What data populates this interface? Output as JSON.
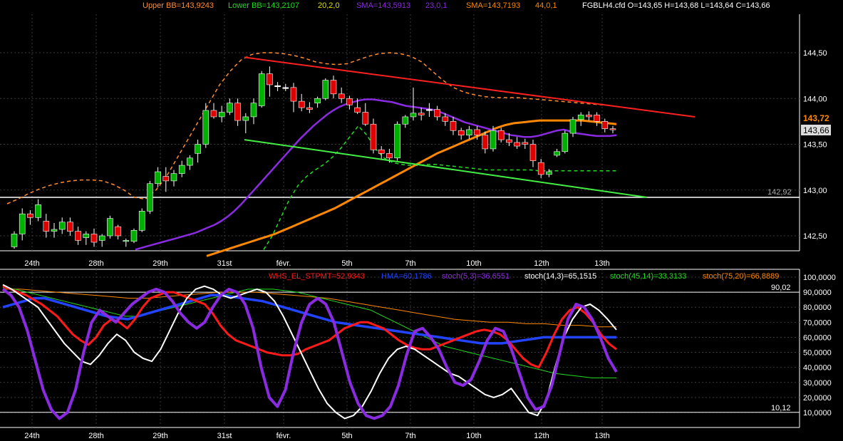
{
  "colors": {
    "background": "#000000",
    "grid": "#3a3a3a",
    "up_candle": "#00b000",
    "down_candle": "#e00000",
    "doji_candle": "#ffffff",
    "bb": "#ff8c33",
    "bb_lower": "#22dd22",
    "sma23": "#8a2be2",
    "sma44": "#ff8800",
    "trend_upper": "#ff2020",
    "trend_lower": "#44ee44",
    "whs": "#ff1a1a",
    "hma": "#2244ff",
    "stoch5": "#8a2be2",
    "stoch14": "#ffffff",
    "stoch45": "#22dd22",
    "stoch75": "#ff8800"
  },
  "header": {
    "upper_bb": "Upper BB=143,9243",
    "lower_bb": "Lower BB=143,2107",
    "bb_params": "20,2,0",
    "sma1": "SMA=143,5913",
    "sma1_params": "23,0,1",
    "sma2": "SMA=143,7193",
    "sma2_params": "44,0,1",
    "ohlc": "FGBLH4.cfd O=143,65 H=143,68 L=143,64 C=143,66"
  },
  "price_badges": {
    "sma": "143,72",
    "last": "143,66",
    "support": "142,92"
  },
  "osc_header": {
    "whs": "WHS_EL_STPMT=52,9343",
    "hma": "HMA=60,1786",
    "stoch5": "stoch(5,3)=36,6551",
    "stoch14": "stoch(14,3)=65,1515",
    "stoch45": "stoch(45,14)=33,3133",
    "stoch75": "stoch(75,20)=66,8889"
  },
  "osc_badges": {
    "upper": "90,02",
    "lower": "10,12"
  },
  "x_labels": [
    "24th",
    "28th",
    "29th",
    "31st",
    "févr.",
    "5th",
    "7th",
    "10th",
    "12th",
    "13th"
  ],
  "chart_data": [
    {
      "type": "candlestick",
      "instrument": "FGBLH4.cfd",
      "ylim": [
        142.35,
        144.62
      ],
      "y_ticks": [
        "142,50",
        "143,00",
        "143,50",
        "144,00",
        "144,50"
      ],
      "horizontal_line": 142.92,
      "candles": [
        [
          142.38,
          142.55,
          142.36,
          142.52
        ],
        [
          142.52,
          142.8,
          142.45,
          142.74
        ],
        [
          142.74,
          142.78,
          142.62,
          142.7
        ],
        [
          142.7,
          142.9,
          142.66,
          142.84
        ],
        [
          142.66,
          142.74,
          142.48,
          142.55
        ],
        [
          142.55,
          142.64,
          142.48,
          142.57
        ],
        [
          142.57,
          142.7,
          142.52,
          142.65
        ],
        [
          142.65,
          142.7,
          142.5,
          142.55
        ],
        [
          142.55,
          142.6,
          142.4,
          142.45
        ],
        [
          142.48,
          142.55,
          142.4,
          142.52
        ],
        [
          142.52,
          142.58,
          142.38,
          142.43
        ],
        [
          142.45,
          142.52,
          142.38,
          142.5
        ],
        [
          142.5,
          142.72,
          142.47,
          142.69
        ],
        [
          142.6,
          142.62,
          142.46,
          142.5
        ],
        [
          142.44,
          142.47,
          142.38,
          142.45
        ],
        [
          142.44,
          142.58,
          142.42,
          142.56
        ],
        [
          142.56,
          142.8,
          142.54,
          142.77
        ],
        [
          142.77,
          143.1,
          142.74,
          143.07
        ],
        [
          143.07,
          143.25,
          143.03,
          143.2
        ],
        [
          143.15,
          143.25,
          142.98,
          143.1
        ],
        [
          143.1,
          143.22,
          143.04,
          143.18
        ],
        [
          143.18,
          143.32,
          143.14,
          143.27
        ],
        [
          143.27,
          143.38,
          143.22,
          143.35
        ],
        [
          143.4,
          143.55,
          143.3,
          143.5
        ],
        [
          143.5,
          143.95,
          143.46,
          143.87
        ],
        [
          143.87,
          143.95,
          143.78,
          143.8
        ],
        [
          143.8,
          143.92,
          143.74,
          143.85
        ],
        [
          143.85,
          144.0,
          143.82,
          143.95
        ],
        [
          143.95,
          144.0,
          143.7,
          143.76
        ],
        [
          143.76,
          143.84,
          143.62,
          143.8
        ],
        [
          143.8,
          144.0,
          143.72,
          143.95
        ],
        [
          143.92,
          144.3,
          143.9,
          144.27
        ],
        [
          144.27,
          144.35,
          144.02,
          144.15
        ],
        [
          144.14,
          144.18,
          144.08,
          144.14
        ],
        [
          144.12,
          144.16,
          144.08,
          144.12
        ],
        [
          144.12,
          144.17,
          143.85,
          143.97
        ],
        [
          143.97,
          144.05,
          143.86,
          143.9
        ],
        [
          143.9,
          143.96,
          143.84,
          143.88
        ],
        [
          143.95,
          144.02,
          143.9,
          144.0
        ],
        [
          144.0,
          144.22,
          143.98,
          144.2
        ],
        [
          144.2,
          144.25,
          144.0,
          144.05
        ],
        [
          144.05,
          144.12,
          143.95,
          144.0
        ],
        [
          144.0,
          144.03,
          143.88,
          143.93
        ],
        [
          143.9,
          144.0,
          143.83,
          143.85
        ],
        [
          143.85,
          143.95,
          143.7,
          143.72
        ],
        [
          143.72,
          143.78,
          143.4,
          143.44
        ],
        [
          143.44,
          143.48,
          143.33,
          143.4
        ],
        [
          143.4,
          143.45,
          143.3,
          143.35
        ],
        [
          143.35,
          143.75,
          143.32,
          143.72
        ],
        [
          143.72,
          143.82,
          143.68,
          143.8
        ],
        [
          143.8,
          144.12,
          143.76,
          143.84
        ],
        [
          143.84,
          143.9,
          143.76,
          143.82
        ],
        [
          143.88,
          143.95,
          143.8,
          143.88
        ],
        [
          143.88,
          143.92,
          143.76,
          143.8
        ],
        [
          143.8,
          143.84,
          143.7,
          143.75
        ],
        [
          143.75,
          143.8,
          143.6,
          143.65
        ],
        [
          143.65,
          143.68,
          143.55,
          143.6
        ],
        [
          143.6,
          143.7,
          143.56,
          143.66
        ],
        [
          143.66,
          143.7,
          143.55,
          143.6
        ],
        [
          143.6,
          143.64,
          143.4,
          143.45
        ],
        [
          143.45,
          143.7,
          143.42,
          143.65
        ],
        [
          143.65,
          143.68,
          143.52,
          143.55
        ],
        [
          143.55,
          143.62,
          143.48,
          143.52
        ],
        [
          143.52,
          143.58,
          143.45,
          143.48
        ],
        [
          143.52,
          143.56,
          143.45,
          143.5
        ],
        [
          143.5,
          143.55,
          143.25,
          143.32
        ],
        [
          143.3,
          143.34,
          143.13,
          143.17
        ],
        [
          143.17,
          143.23,
          143.14,
          143.2
        ],
        [
          143.38,
          143.45,
          143.36,
          143.42
        ],
        [
          143.42,
          143.65,
          143.4,
          143.62
        ],
        [
          143.62,
          143.8,
          143.58,
          143.77
        ],
        [
          143.77,
          143.85,
          143.7,
          143.82
        ],
        [
          143.82,
          143.86,
          143.76,
          143.8
        ],
        [
          143.82,
          143.85,
          143.7,
          143.75
        ],
        [
          143.75,
          143.78,
          143.63,
          143.67
        ],
        [
          143.67,
          143.7,
          143.62,
          143.66
        ]
      ],
      "sma23": [
        142.35,
        142.37,
        142.39,
        142.41,
        142.43,
        142.45,
        142.47,
        142.49,
        142.51,
        142.53,
        142.56,
        142.59,
        142.62,
        142.66,
        142.71,
        142.77,
        142.84,
        142.92,
        143.0,
        143.08,
        143.16,
        143.24,
        143.32,
        143.4,
        143.48,
        143.56,
        143.63,
        143.7,
        143.76,
        143.82,
        143.87,
        143.91,
        143.94,
        143.96,
        143.98,
        143.99,
        143.99,
        143.98,
        143.97,
        143.96,
        143.94,
        143.92,
        143.91,
        143.9,
        143.89,
        143.88,
        143.86,
        143.83,
        143.8,
        143.77,
        143.74,
        143.72,
        143.7,
        143.68,
        143.66,
        143.64,
        143.62,
        143.6,
        143.59,
        143.58,
        143.58,
        143.59,
        143.61,
        143.63,
        143.65,
        143.66,
        143.64,
        143.62,
        143.61,
        143.6,
        143.59,
        143.59,
        143.59,
        143.6
      ],
      "sma44": [
        142.28,
        142.31,
        142.34,
        142.37,
        142.4,
        142.43,
        142.46,
        142.49,
        142.52,
        142.56,
        142.6,
        142.64,
        142.68,
        142.72,
        142.76,
        142.8,
        142.85,
        142.9,
        142.95,
        143.0,
        143.05,
        143.1,
        143.15,
        143.2,
        143.25,
        143.3,
        143.35,
        143.4,
        143.44,
        143.48,
        143.52,
        143.56,
        143.6,
        143.64,
        143.68,
        143.71,
        143.73,
        143.74,
        143.75,
        143.76,
        143.76,
        143.76,
        143.76,
        143.76,
        143.76,
        143.75,
        143.74,
        143.73,
        143.72
      ],
      "bb_upper": [
        142.85,
        142.9,
        142.96,
        143.01,
        143.05,
        143.08,
        143.1,
        143.11,
        143.11,
        143.1,
        143.06,
        143.0,
        142.92,
        142.9,
        143.0,
        143.15,
        143.35,
        143.55,
        143.75,
        143.95,
        144.15,
        144.3,
        144.42,
        144.48,
        144.5,
        144.5,
        144.49,
        144.47,
        144.44,
        144.4,
        144.38,
        144.37,
        144.38,
        144.42,
        144.46,
        144.49,
        144.5,
        144.49,
        144.46,
        144.4,
        144.3,
        144.2,
        144.12,
        144.07,
        144.04,
        144.02,
        144.01,
        144.01,
        144.01,
        144.0,
        143.99,
        143.98,
        143.97,
        143.96,
        143.95,
        143.94,
        143.93,
        143.92
      ],
      "bb_lower": [
        142.35,
        142.5,
        142.7,
        142.9,
        143.05,
        143.15,
        143.22,
        143.28,
        143.36,
        143.46,
        143.58,
        143.7,
        143.6,
        143.45,
        143.35,
        143.3,
        143.28,
        143.27,
        143.27,
        143.28,
        143.28,
        143.27,
        143.26,
        143.25,
        143.24,
        143.23,
        143.22,
        143.22,
        143.22,
        143.22,
        143.22,
        143.22,
        143.21,
        143.21,
        143.21,
        143.21,
        143.21,
        143.21,
        143.21,
        143.21,
        143.21,
        143.21
      ],
      "trendlines": [
        {
          "from": [
            0,
            144.45
          ],
          "to": [
            1,
            143.8
          ]
        },
        {
          "from": [
            0,
            143.55
          ],
          "to": [
            1,
            142.92
          ]
        }
      ]
    },
    {
      "type": "line",
      "ylim": [
        0,
        100
      ],
      "y_ticks": [
        "10,0000",
        "20,0000",
        "30,0000",
        "40,0000",
        "50,0000",
        "60,0000",
        "70,0000",
        "80,0000",
        "90,0000",
        "100,0000"
      ],
      "levels": [
        90.02,
        10.12
      ],
      "series": [
        {
          "name": "WHS_EL_STPMT",
          "values": [
            94,
            92,
            90,
            88,
            85,
            82,
            78,
            74,
            68,
            62,
            58,
            55,
            60,
            68,
            72,
            70,
            66,
            72,
            80,
            86,
            88,
            90,
            90,
            88,
            86,
            84,
            82,
            76,
            68,
            62,
            58,
            56,
            54,
            52,
            50,
            49,
            48,
            48,
            49,
            52,
            54,
            56,
            58,
            62,
            66,
            68,
            70,
            70,
            68,
            66,
            62,
            58,
            55,
            53,
            52,
            52,
            54,
            56,
            58,
            60,
            62,
            64,
            65,
            64,
            62,
            58,
            52,
            46,
            42,
            40,
            50,
            62,
            72,
            78,
            80,
            76,
            70,
            62,
            56,
            52
          ]
        },
        {
          "name": "HMA",
          "values": [
            80,
            82,
            84,
            86,
            86,
            84,
            82,
            80,
            78,
            76,
            74,
            73,
            72,
            74,
            76,
            78,
            80,
            82,
            84,
            86,
            88,
            88,
            87,
            86,
            85,
            84,
            82,
            80,
            78,
            76,
            74,
            72,
            70,
            69,
            68,
            67,
            66,
            65,
            64,
            63,
            62,
            61,
            60,
            59,
            58,
            57,
            56,
            56,
            56,
            57,
            58,
            59,
            60,
            60,
            60,
            60,
            60,
            60,
            60,
            60
          ]
        },
        {
          "name": "stoch(5,3)",
          "values": [
            92,
            88,
            80,
            65,
            45,
            25,
            12,
            6,
            10,
            25,
            50,
            70,
            78,
            74,
            70,
            76,
            82,
            86,
            90,
            92,
            90,
            84,
            76,
            70,
            66,
            70,
            80,
            88,
            92,
            90,
            82,
            66,
            40,
            20,
            14,
            25,
            50,
            70,
            82,
            86,
            82,
            70,
            50,
            30,
            16,
            8,
            6,
            8,
            14,
            28,
            48,
            64,
            66,
            60,
            52,
            40,
            30,
            28,
            32,
            44,
            58,
            66,
            64,
            52,
            36,
            20,
            12,
            14,
            28,
            50,
            72,
            82,
            80,
            72,
            60,
            46,
            37
          ]
        },
        {
          "name": "stoch(14,3)",
          "values": [
            95,
            92,
            88,
            84,
            80,
            72,
            64,
            56,
            50,
            44,
            42,
            48,
            56,
            62,
            58,
            50,
            46,
            44,
            52,
            64,
            76,
            86,
            92,
            94,
            92,
            88,
            86,
            88,
            90,
            92,
            90,
            84,
            74,
            62,
            50,
            38,
            26,
            16,
            10,
            6,
            8,
            14,
            24,
            36,
            46,
            52,
            54,
            52,
            48,
            44,
            40,
            36,
            34,
            30,
            26,
            22,
            20,
            22,
            26,
            18,
            10,
            8,
            18,
            40,
            60,
            72,
            80,
            82,
            78,
            72,
            65
          ]
        },
        {
          "name": "stoch(45,14)",
          "values": [
            93,
            92,
            90,
            88,
            86,
            84,
            82,
            80,
            78,
            76,
            74,
            74,
            76,
            78,
            80,
            82,
            84,
            86,
            88,
            90,
            92,
            92,
            92,
            91,
            90,
            88,
            86,
            84,
            82,
            80,
            78,
            74,
            70,
            66,
            62,
            58,
            54,
            52,
            50,
            48,
            46,
            44,
            42,
            40,
            38,
            36,
            35,
            34,
            33,
            33,
            33
          ]
        },
        {
          "name": "stoch(75,20)",
          "values": [
            92,
            92,
            91,
            90,
            89,
            88,
            87,
            86,
            86,
            87,
            88,
            89,
            90,
            90,
            90,
            89,
            88,
            87,
            86,
            84,
            82,
            80,
            78,
            76,
            74,
            72,
            71,
            70,
            70,
            69,
            69,
            68,
            68,
            67,
            67
          ]
        }
      ]
    }
  ]
}
